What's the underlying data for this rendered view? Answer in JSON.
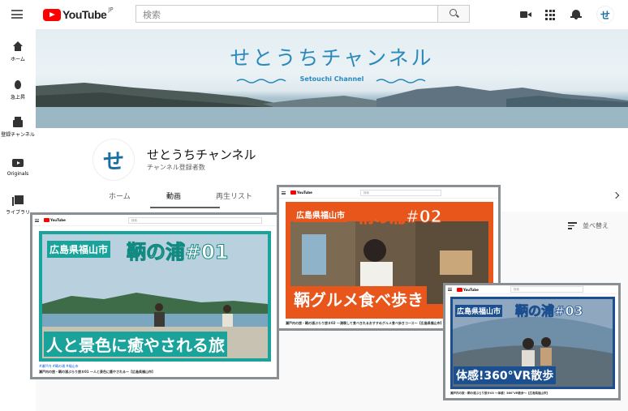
{
  "header": {
    "logo_text": "YouTube",
    "region": "JP",
    "search_placeholder": "検索",
    "avatar_glyph": "せ"
  },
  "sidebar": {
    "items": [
      {
        "label": "ホーム",
        "icon": "home-icon"
      },
      {
        "label": "急上昇",
        "icon": "trending-icon"
      },
      {
        "label": "登録チャンネル",
        "icon": "subscriptions-icon"
      },
      {
        "label": "Originals",
        "icon": "originals-icon"
      },
      {
        "label": "ライブラリ",
        "icon": "library-icon"
      }
    ]
  },
  "banner": {
    "title": "せとうちチャンネル",
    "subtitle": "Setouchi Channel"
  },
  "channel": {
    "avatar_glyph": "せ",
    "name": "せとうちチャンネル",
    "subscribers": "チャンネル登録者数"
  },
  "tabs": [
    "ホーム",
    "動画",
    "再生リスト"
  ],
  "active_tab": "動画",
  "sort_label": "並べ替え",
  "cards": [
    {
      "logo_text": "YouTube",
      "search_placeholder": "検索",
      "prefecture": "広島県福山市",
      "title": "鞆の浦#01",
      "subtitle": "人と景色に癒やされる旅",
      "meta_date": "#瀬戸内 #鞆の浦 #福山市",
      "meta_title": "瀬戸内の旅・鞆の浦ぶらり旅＃01 〜人と景色に癒やされる〜【広島県福山市】"
    },
    {
      "logo_text": "YouTube",
      "search_placeholder": "検索",
      "prefecture": "広島県福山市",
      "title": "鞆の浦#02",
      "subtitle": "鞆グルメ食べ歩き",
      "meta_title": "瀬戸内の旅・鞆の浦ぶらり旅＃02 〜満喫して食べきれるおすすめグルメ食べ歩きコース〜【広島県福山市】"
    },
    {
      "logo_text": "YouTube",
      "search_placeholder": "検索",
      "prefecture": "広島県福山市",
      "title": "鞆の浦#03",
      "subtitle": "体感!360°VR散歩",
      "meta_title": "瀬戸内の旅・鞆の浦ぶらり旅＃03 〜体感！360°VR散歩〜【広島県福山市】"
    }
  ],
  "colors": {
    "brand_red": "#ff0000",
    "setouchi_blue": "#2a89bd",
    "card1_accent": "#1aa39a",
    "card2_accent": "#e8561c",
    "card3_accent": "#1b4f8f"
  }
}
